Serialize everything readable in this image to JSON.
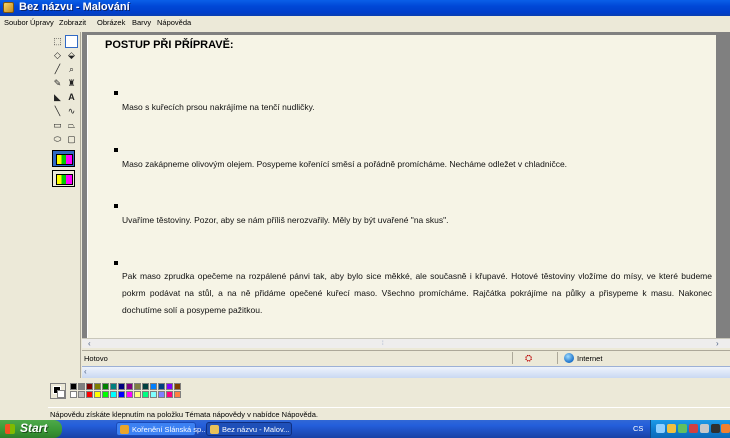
{
  "window": {
    "title": "Bez názvu - Malování"
  },
  "menu": [
    "Soubor",
    "Úpravy",
    "Zobrazit",
    "Obrázek",
    "Barvy",
    "Nápověda"
  ],
  "toolbox": {
    "tools": [
      {
        "name": "free-select-icon",
        "glyph": "⬚"
      },
      {
        "name": "rect-select-icon",
        "glyph": "▭"
      },
      {
        "name": "eraser-icon",
        "glyph": "◇"
      },
      {
        "name": "fill-bucket-icon",
        "glyph": "⬙"
      },
      {
        "name": "color-picker-icon",
        "glyph": "╱"
      },
      {
        "name": "magnifier-icon",
        "glyph": "🔍"
      },
      {
        "name": "pencil-icon",
        "glyph": "✎"
      },
      {
        "name": "brush-icon",
        "glyph": "♜"
      },
      {
        "name": "airbrush-icon",
        "glyph": "◣"
      },
      {
        "name": "text-icon",
        "glyph": "A"
      },
      {
        "name": "line-icon",
        "glyph": "╲"
      },
      {
        "name": "curve-icon",
        "glyph": "∿"
      },
      {
        "name": "rectangle-icon",
        "glyph": "▬"
      },
      {
        "name": "polygon-icon",
        "glyph": "⏢"
      },
      {
        "name": "ellipse-icon",
        "glyph": "⬭"
      },
      {
        "name": "rounded-rect-icon",
        "glyph": "▢"
      }
    ]
  },
  "document": {
    "heading": "POSTUP PŘI PŘÍPRAVĚ:",
    "steps": [
      "Maso s kuřecích prsou nakrájíme na tenčí nudličky.",
      "Maso zakápneme olivovým olejem. Posypeme kořenící směsí a pořádně promícháme. Necháme odležet v chladničce.",
      "Uvaříme těstoviny. Pozor, aby se nám příliš nerozvařily. Měly by být uvařené \"na skus\".",
      "Pak maso zprudka opečeme na rozpálené pánvi tak, aby bylo sice měkké, ale současně i křupavé. Hotové těstoviny vložíme do mísy, ve které budeme pokrm podávat na stůl, a na ně přidáme opečené kuřecí maso. Všechno promícháme. Rajčátka pokrájíme na půlky a přisypeme k masu. Nakonec dochutíme solí a posypeme pažitkou."
    ]
  },
  "browser_status": {
    "left_text": "Hotovo",
    "zone_text": "Internet"
  },
  "palette": {
    "colors": [
      "#000000",
      "#808080",
      "#800000",
      "#808000",
      "#008000",
      "#008080",
      "#000080",
      "#800080",
      "#808040",
      "#004040",
      "#0080ff",
      "#004080",
      "#8000ff",
      "#804000",
      "#ffffff",
      "#c0c0c0",
      "#ff0000",
      "#ffff00",
      "#00ff00",
      "#00ffff",
      "#0000ff",
      "#ff00ff",
      "#ffff80",
      "#00ff80",
      "#80ffff",
      "#8080ff",
      "#ff0080",
      "#ff8040"
    ]
  },
  "help_bar": {
    "text": "Nápovědu získáte klepnutím na položku Témata nápovědy v nabídce Nápověda."
  },
  "taskbar": {
    "start_label": "Start",
    "tasks": [
      {
        "label": "Kořenění Slánská sp...",
        "active": false
      },
      {
        "label": "Bez názvu - Malov...",
        "active": true
      }
    ],
    "language": "CS"
  }
}
